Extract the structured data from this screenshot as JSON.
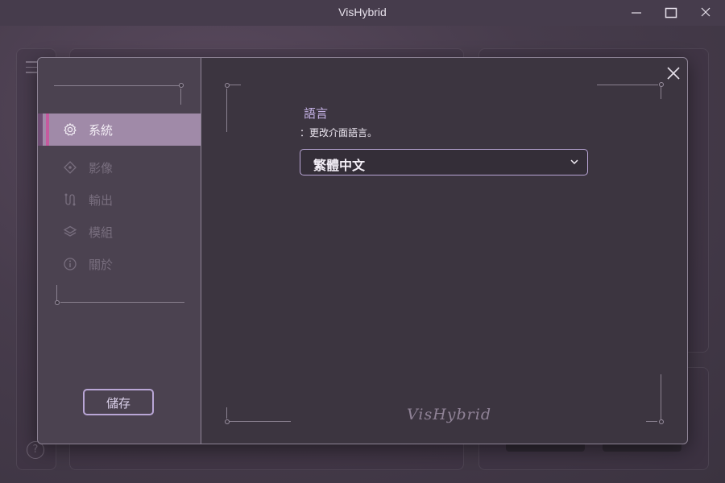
{
  "window": {
    "title": "VisHybrid",
    "controls": [
      "minimize-icon",
      "maximize-icon",
      "close-icon"
    ]
  },
  "background": {
    "help_symbol": "?"
  },
  "dialog": {
    "sidebar": {
      "items": [
        {
          "label": "系統",
          "icon": "gear-icon",
          "active": true
        },
        {
          "label": "影像",
          "icon": "image-diamond-icon",
          "active": false
        },
        {
          "label": "輸出",
          "icon": "output-path-icon",
          "active": false
        },
        {
          "label": "模組",
          "icon": "layers-icon",
          "active": false
        },
        {
          "label": "關於",
          "icon": "info-icon",
          "active": false
        }
      ],
      "save_label": "儲存"
    },
    "content": {
      "section_title": "語言",
      "section_desc": "：更改介面語言。",
      "language_dropdown": {
        "selected": "繁體中文"
      }
    },
    "brand_text": "VisHybrid"
  },
  "colors": {
    "accent": "#b9a6d6",
    "active_item_bg": "#a08aa8",
    "active_marker": "#c55a9e",
    "title_accent": "#c4b1e4"
  }
}
